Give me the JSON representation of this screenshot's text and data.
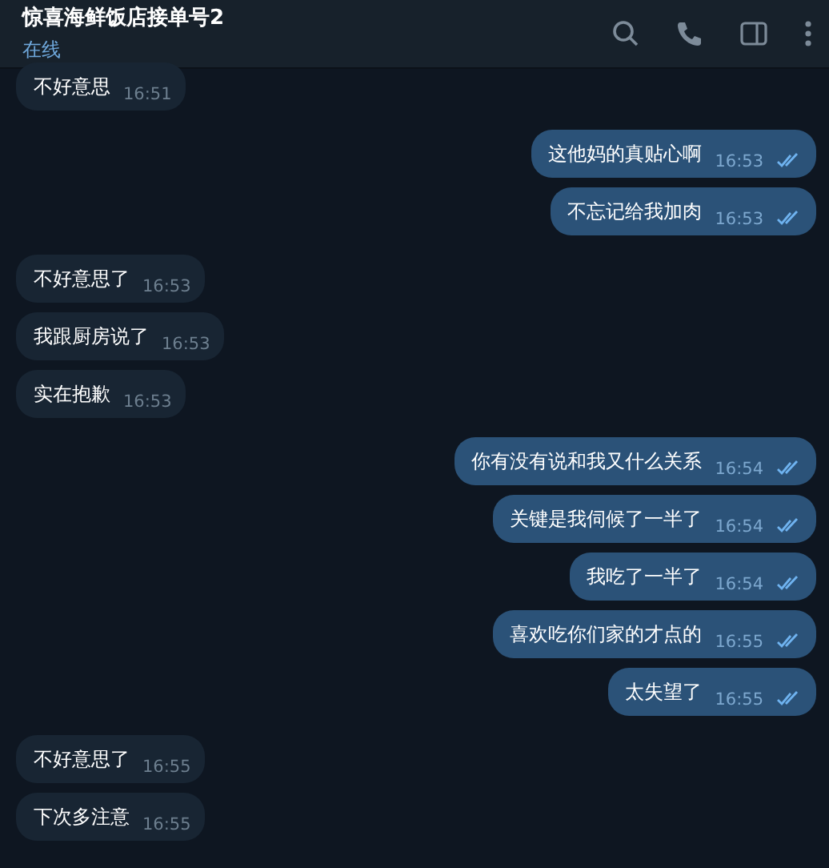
{
  "header": {
    "title": "惊喜海鲜饭店接单号2",
    "status": "在线"
  },
  "groups": [
    {
      "outgoing": false,
      "messages": [
        {
          "text": "不好意思",
          "time": "16:51"
        }
      ]
    },
    {
      "outgoing": true,
      "messages": [
        {
          "text": "这他妈的真贴心啊",
          "time": "16:53",
          "read": true
        },
        {
          "text": "不忘记给我加肉",
          "time": "16:53",
          "read": true
        }
      ]
    },
    {
      "outgoing": false,
      "messages": [
        {
          "text": "不好意思了",
          "time": "16:53"
        },
        {
          "text": "我跟厨房说了",
          "time": "16:53"
        },
        {
          "text": "实在抱歉",
          "time": "16:53"
        }
      ]
    },
    {
      "outgoing": true,
      "messages": [
        {
          "text": "你有没有说和我又什么关系",
          "time": "16:54",
          "read": true
        },
        {
          "text": "关键是我伺候了一半了",
          "time": "16:54",
          "read": true
        },
        {
          "text": "我吃了一半了",
          "time": "16:54",
          "read": true
        },
        {
          "text": "喜欢吃你们家的才点的",
          "time": "16:55",
          "read": true
        },
        {
          "text": "太失望了",
          "time": "16:55",
          "read": true
        }
      ]
    },
    {
      "outgoing": false,
      "messages": [
        {
          "text": "不好意思了",
          "time": "16:55"
        },
        {
          "text": "下次多注意",
          "time": "16:55"
        }
      ]
    }
  ]
}
